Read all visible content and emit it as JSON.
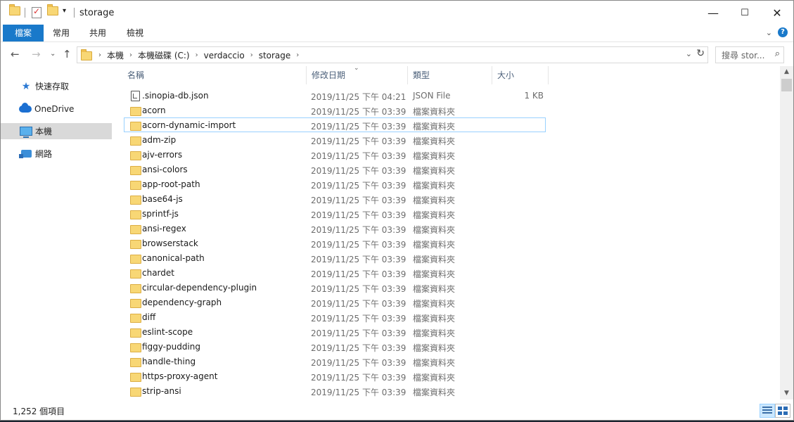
{
  "window": {
    "title": "storage",
    "minimize": "—",
    "maximize": "☐",
    "close": "✕"
  },
  "ribbon": {
    "tabs": [
      "檔案",
      "常用",
      "共用",
      "檢視"
    ]
  },
  "address": {
    "crumbs": [
      "本機",
      "本機磁碟 (C:)",
      "verdaccio",
      "storage"
    ]
  },
  "search": {
    "placeholder": "搜尋 stor..."
  },
  "sidebar": {
    "items": [
      {
        "label": "快速存取",
        "icon": "star-icon"
      },
      {
        "label": "OneDrive",
        "icon": "cloud-icon"
      },
      {
        "label": "本機",
        "icon": "computer-icon",
        "selected": true
      },
      {
        "label": "網路",
        "icon": "network-icon"
      }
    ]
  },
  "columns": {
    "name": "名稱",
    "date": "修改日期",
    "type": "類型",
    "size": "大小"
  },
  "files": [
    {
      "name": ".sinopia-db.json",
      "date": "2019/11/25 下午 04:21",
      "type": "JSON File",
      "size": "1 KB",
      "kind": "json"
    },
    {
      "name": "acorn",
      "date": "2019/11/25 下午 03:39",
      "type": "檔案資料夾",
      "size": "",
      "kind": "folder"
    },
    {
      "name": "acorn-dynamic-import",
      "date": "2019/11/25 下午 03:39",
      "type": "檔案資料夾",
      "size": "",
      "kind": "folder",
      "focused": true
    },
    {
      "name": "adm-zip",
      "date": "2019/11/25 下午 03:39",
      "type": "檔案資料夾",
      "size": "",
      "kind": "folder"
    },
    {
      "name": "ajv-errors",
      "date": "2019/11/25 下午 03:39",
      "type": "檔案資料夾",
      "size": "",
      "kind": "folder"
    },
    {
      "name": "ansi-colors",
      "date": "2019/11/25 下午 03:39",
      "type": "檔案資料夾",
      "size": "",
      "kind": "folder"
    },
    {
      "name": "app-root-path",
      "date": "2019/11/25 下午 03:39",
      "type": "檔案資料夾",
      "size": "",
      "kind": "folder"
    },
    {
      "name": "base64-js",
      "date": "2019/11/25 下午 03:39",
      "type": "檔案資料夾",
      "size": "",
      "kind": "folder"
    },
    {
      "name": "sprintf-js",
      "date": "2019/11/25 下午 03:39",
      "type": "檔案資料夾",
      "size": "",
      "kind": "folder"
    },
    {
      "name": "ansi-regex",
      "date": "2019/11/25 下午 03:39",
      "type": "檔案資料夾",
      "size": "",
      "kind": "folder"
    },
    {
      "name": "browserstack",
      "date": "2019/11/25 下午 03:39",
      "type": "檔案資料夾",
      "size": "",
      "kind": "folder"
    },
    {
      "name": "canonical-path",
      "date": "2019/11/25 下午 03:39",
      "type": "檔案資料夾",
      "size": "",
      "kind": "folder"
    },
    {
      "name": "chardet",
      "date": "2019/11/25 下午 03:39",
      "type": "檔案資料夾",
      "size": "",
      "kind": "folder"
    },
    {
      "name": "circular-dependency-plugin",
      "date": "2019/11/25 下午 03:39",
      "type": "檔案資料夾",
      "size": "",
      "kind": "folder"
    },
    {
      "name": "dependency-graph",
      "date": "2019/11/25 下午 03:39",
      "type": "檔案資料夾",
      "size": "",
      "kind": "folder"
    },
    {
      "name": "diff",
      "date": "2019/11/25 下午 03:39",
      "type": "檔案資料夾",
      "size": "",
      "kind": "folder"
    },
    {
      "name": "eslint-scope",
      "date": "2019/11/25 下午 03:39",
      "type": "檔案資料夾",
      "size": "",
      "kind": "folder"
    },
    {
      "name": "figgy-pudding",
      "date": "2019/11/25 下午 03:39",
      "type": "檔案資料夾",
      "size": "",
      "kind": "folder"
    },
    {
      "name": "handle-thing",
      "date": "2019/11/25 下午 03:39",
      "type": "檔案資料夾",
      "size": "",
      "kind": "folder"
    },
    {
      "name": "https-proxy-agent",
      "date": "2019/11/25 下午 03:39",
      "type": "檔案資料夾",
      "size": "",
      "kind": "folder"
    },
    {
      "name": "strip-ansi",
      "date": "2019/11/25 下午 03:39",
      "type": "檔案資料夾",
      "size": "",
      "kind": "folder"
    }
  ],
  "status": {
    "count": "1,252 個項目"
  }
}
